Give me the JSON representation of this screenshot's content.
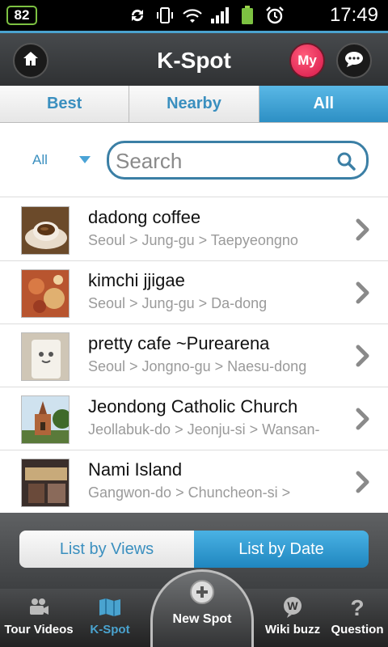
{
  "status_bar": {
    "battery_level": "82",
    "time": "17:49",
    "icons": [
      "sync-icon",
      "vibrate-icon",
      "wifi-icon",
      "signal-icon",
      "battery-icon",
      "alarm-icon"
    ]
  },
  "header": {
    "title": "K-Spot",
    "my_label": "My"
  },
  "tabs": [
    {
      "label": "Best",
      "active": false
    },
    {
      "label": "Nearby",
      "active": false
    },
    {
      "label": "All",
      "active": true
    }
  ],
  "search": {
    "filter_value": "All",
    "placeholder": "Search"
  },
  "list": [
    {
      "title": "dadong coffee",
      "location": "Seoul > Jung-gu > Taepyeongno"
    },
    {
      "title": "kimchi jjigae",
      "location": "Seoul > Jung-gu > Da-dong"
    },
    {
      "title": "pretty cafe ~Purearena",
      "location": "Seoul > Jongno-gu > Naesu-dong"
    },
    {
      "title": "Jeondong Catholic Church",
      "location": "Jeollabuk-do > Jeonju-si > Wansan-"
    },
    {
      "title": "Nami Island",
      "location": "Gangwon-do > Chuncheon-si >"
    }
  ],
  "sort": {
    "views_label": "List by Views",
    "date_label": "List by Date",
    "selected": "date"
  },
  "tabbar": {
    "items": [
      {
        "label": "Tour Videos",
        "icon": "camera-icon"
      },
      {
        "label": "K-Spot",
        "icon": "map-icon",
        "active": true
      },
      {
        "label": "New Spot",
        "icon": "plus-icon"
      },
      {
        "label": "Wiki buzz",
        "icon": "wiki-icon"
      },
      {
        "label": "Question",
        "icon": "question-icon"
      }
    ]
  },
  "colors": {
    "accent": "#3a8fbf",
    "header_bg": "#3a3c3e",
    "my_button": "#e0224f"
  }
}
